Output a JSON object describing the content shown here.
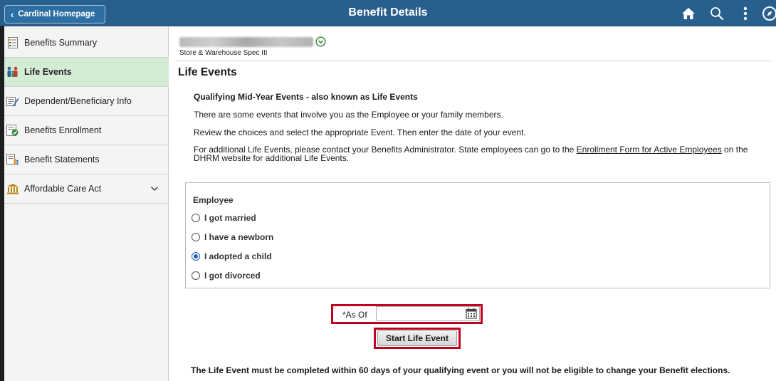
{
  "header": {
    "back_label": "Cardinal Homepage",
    "title": "Benefit Details",
    "icons": [
      "home-icon",
      "search-icon",
      "more-menu-icon",
      "nav-icon"
    ],
    "colors": {
      "bar": "#295f8d",
      "active_item": "#d4ecd4",
      "highlight": "#c00020"
    }
  },
  "sidebar": {
    "items": [
      {
        "label": "Benefits Summary",
        "icon": "summary-icon"
      },
      {
        "label": "Life Events",
        "icon": "family-icon",
        "active": true
      },
      {
        "label": "Dependent/Beneficiary Info",
        "icon": "dependent-icon"
      },
      {
        "label": "Benefits Enrollment",
        "icon": "enrollment-icon"
      },
      {
        "label": "Benefit Statements",
        "icon": "statement-icon"
      },
      {
        "label": "Affordable Care Act",
        "icon": "building-icon",
        "expandable": true
      }
    ]
  },
  "employee": {
    "job_title": "Store & Warehouse Spec III"
  },
  "main": {
    "section_title": "Life Events",
    "intro_heading": "Qualifying Mid-Year Events - also known as Life Events",
    "intro_p1": "There are some events that involve you as the Employee or your family members.",
    "intro_p2": "Review the choices and select the appropriate Event. Then enter the date of your event.",
    "intro_p3_before": "For additional Life Events, please contact your Benefits Administrator. State employees can go to the ",
    "intro_p3_link": "Enrollment Form for Active Employees",
    "intro_p3_after": " on the DHRM website for additional Life Events.",
    "events_group_title": "Employee",
    "events": [
      {
        "label": "I got married",
        "checked": false
      },
      {
        "label": "I have a newborn",
        "checked": false
      },
      {
        "label": "I adopted a child",
        "checked": true
      },
      {
        "label": "I got divorced",
        "checked": false
      }
    ],
    "as_of_label": "*As Of",
    "as_of_value": "",
    "start_button": "Start Life Event",
    "footer_note": "The Life Event must be completed within 60 days of your qualifying event or you will not be eligible to change your Benefit elections."
  }
}
